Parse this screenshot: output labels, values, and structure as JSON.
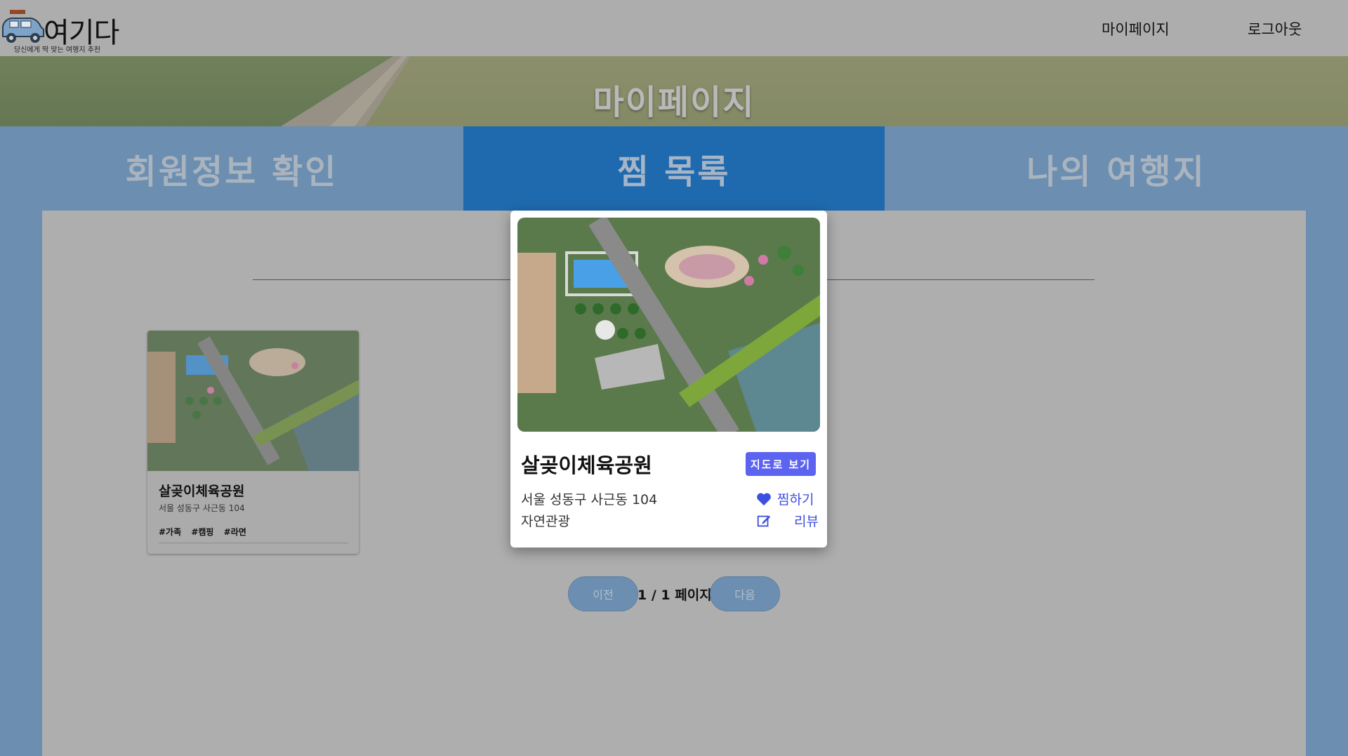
{
  "header": {
    "logo_title": "여기다",
    "logo_subtitle": "당신에게 딱 맞는 여행지 추천",
    "nav": {
      "mypage": "마이페이지",
      "logout": "로그아웃"
    }
  },
  "banner": {
    "title": "마이페이지"
  },
  "tabs": [
    {
      "label": "회원정보 확인",
      "active": false
    },
    {
      "label": "찜 목록",
      "active": true
    },
    {
      "label": "나의 여행지",
      "active": false
    }
  ],
  "card": {
    "title": "살곶이체육공원",
    "address": "서울 성동구 사근동 104",
    "tags": [
      "#가족",
      "#캠핑",
      "#라면"
    ]
  },
  "pagination": {
    "prev": "이전",
    "info": "1 / 1 페이지",
    "next": "다음"
  },
  "modal": {
    "title": "살곶이체육공원",
    "map_button": "지도로 보기",
    "address": "서울 성동구 사근동 104",
    "category": "자연관광",
    "like_label": "찜하기",
    "review_label": "리뷰"
  },
  "colors": {
    "tab_active": "#1f69ae",
    "tab_inactive": "#6b8eb1",
    "map_button": "#5b63f0",
    "link": "#3d4fe0"
  }
}
